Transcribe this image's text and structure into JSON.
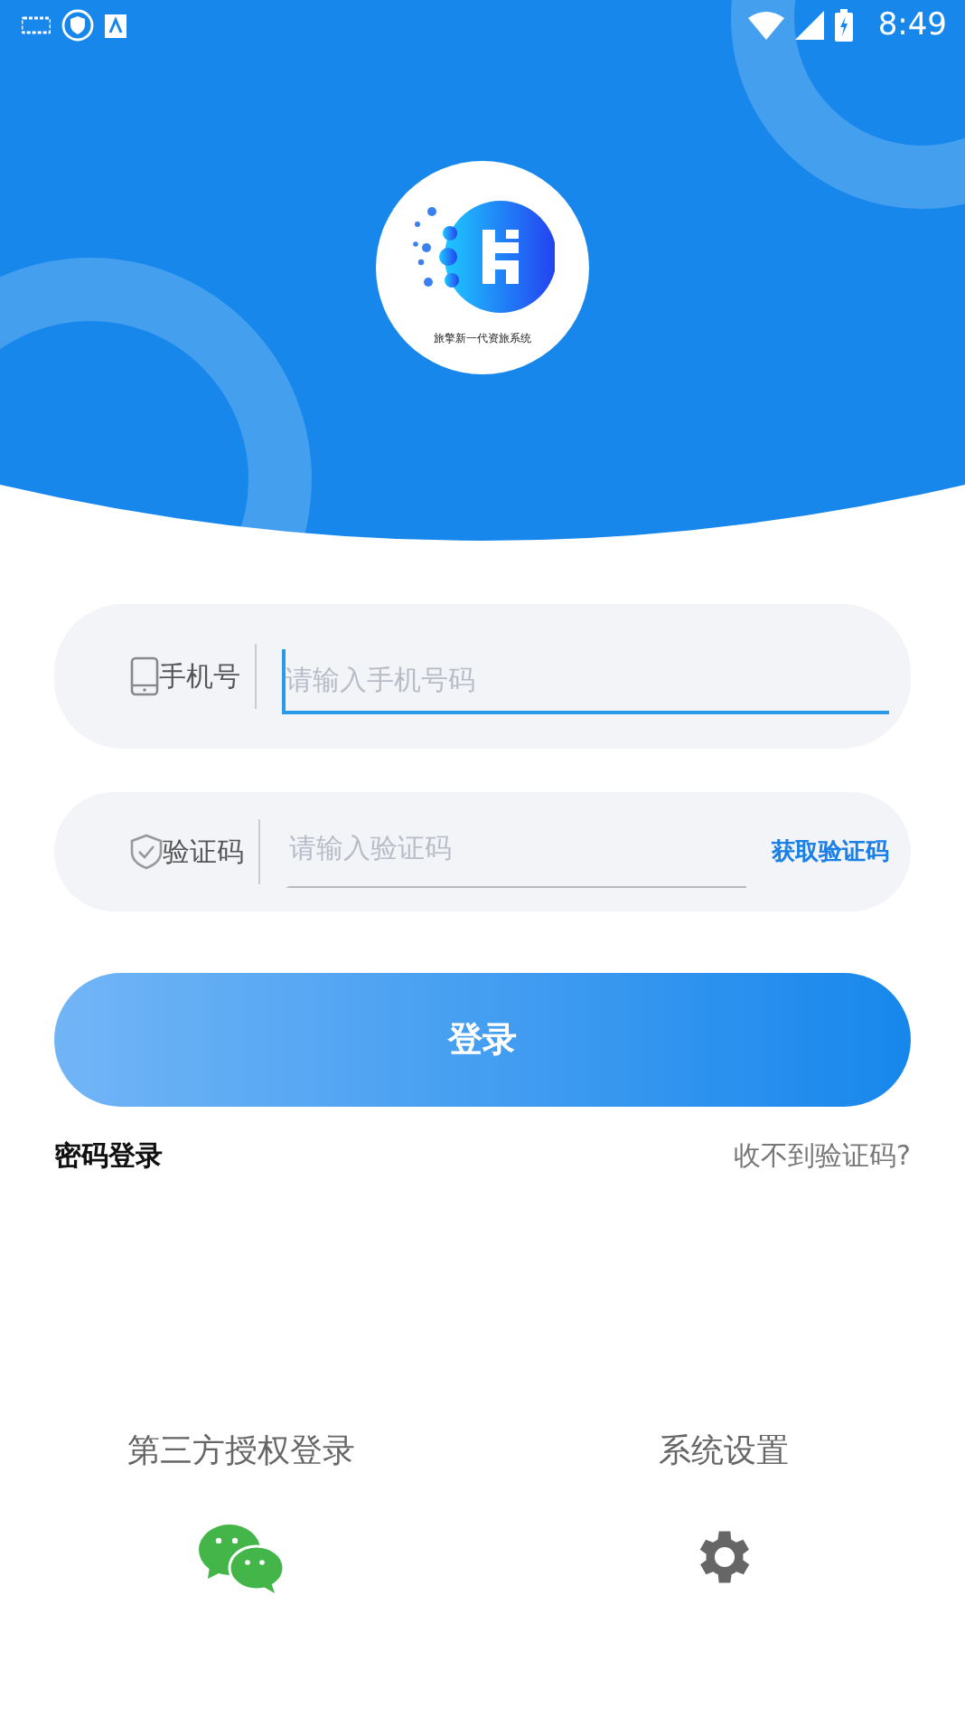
{
  "status_bar": {
    "time": "8:49"
  },
  "logo": {
    "caption": "旅擎新一代资旅系统"
  },
  "fields": [
    {
      "kind": "phone",
      "label": "手机号",
      "placeholder": "请输入手机号码",
      "focused": true
    },
    {
      "kind": "code",
      "label": "验证码",
      "placeholder": "请输入验证码",
      "focused": false,
      "action": "获取验证码"
    }
  ],
  "login_button": "登录",
  "links": {
    "left": "密码登录",
    "right": "收不到验证码?"
  },
  "bottom": [
    {
      "kind": "wechat",
      "label": "第三方授权登录"
    },
    {
      "kind": "settings",
      "label": "系统设置"
    }
  ]
}
